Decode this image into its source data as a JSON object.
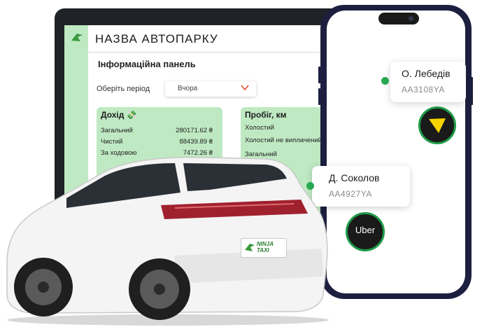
{
  "dashboard": {
    "title": "НАЗВА АВТОПАРКУ",
    "panel_title": "Інформаційна панель",
    "period_label": "Оберіть період",
    "period_value": "Вчора",
    "income_card": {
      "title": "Дохід 💸",
      "rows": [
        {
          "label": "Загальний",
          "value": "280171.62 ₴"
        },
        {
          "label": "Чистий",
          "value": "88439.89 ₴"
        },
        {
          "label": "За ходовою",
          "value": "7472.26 ₴"
        }
      ]
    },
    "mileage_card": {
      "title": "Пробіг, км",
      "rows": [
        {
          "label": "Холостий"
        },
        {
          "label": "Холостий не виплачений"
        },
        {
          "label": "Загальний"
        }
      ]
    }
  },
  "drivers": [
    {
      "name": "О. Лебедів",
      "plate": "AA3108YA",
      "provider": "bolt-icon"
    },
    {
      "name": "Д. Соколов",
      "plate": "AA4927YA",
      "provider": "uber"
    }
  ],
  "providers": {
    "uber_label": "Uber"
  },
  "car": {
    "plate_brand": "NINJA TAXI"
  },
  "colors": {
    "accent_green": "#bfe9c2",
    "status_dot": "#27a853",
    "phone_frame": "#1c1f3f",
    "bolt_yellow": "#f5d400"
  }
}
